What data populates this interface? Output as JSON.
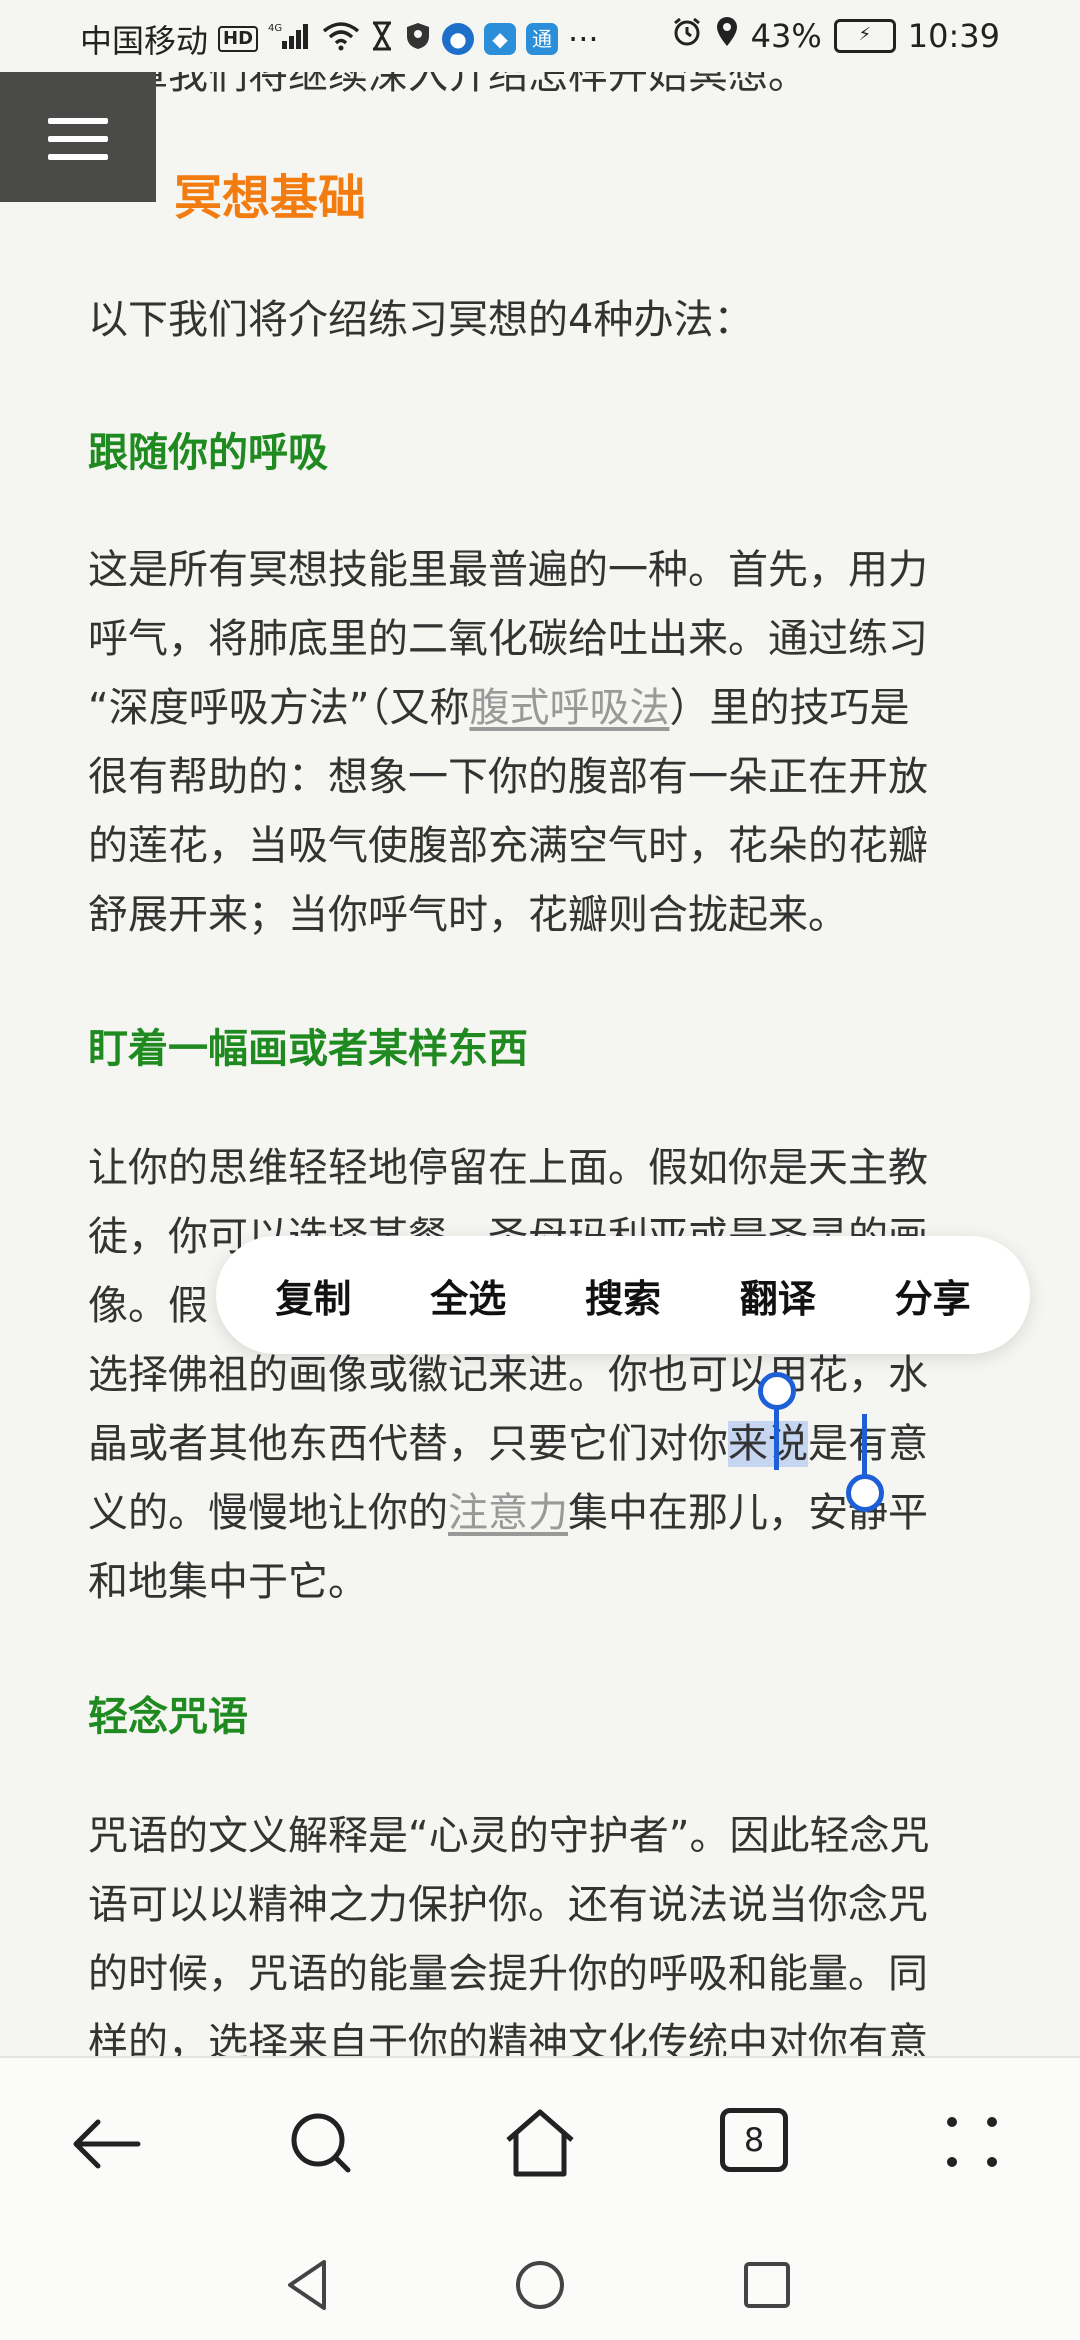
{
  "status_bar": {
    "carrier": "中国移动",
    "hd_badge": "HD",
    "network": "4G",
    "battery": "43%",
    "time": "10:39",
    "more": "···"
  },
  "article": {
    "cut_line": "文章我们将继续深入介绍怎样开始冥想。",
    "section_title": "冥想基础",
    "intro": "以下我们将介绍练习冥想的4种办法：",
    "sections": [
      {
        "heading": "跟随你的呼吸",
        "lines": [
          "这是所有冥想技能里最普遍的一种。首先，用力",
          "呼气，将肺底里的二氧化碳给吐出来。通过练习",
          "“深度呼吸方法”（又称",
          "腹式呼吸法",
          "）里的技巧是",
          "很有帮助的：想象一下你的腹部有一朵正在开放",
          "的莲花，当吸气使腹部充满空气时，花朵的花瓣",
          "舒展开来；当你呼气时，花瓣则合拢起来。"
        ]
      },
      {
        "heading": "盯着一幅画或者某样东西",
        "lines": [
          "让你的思维轻轻地停留在上面。假如你是天主教",
          "徒，你可以选择某餐、圣母玛利亚或是圣灵的画",
          "像。假",
          "选择佛祖的画像或徽记来进。你也可以用花，水",
          "晶或者其他东西代替，只要它们对你",
          "来说",
          "是有意",
          "义的。慢慢地让你的",
          "注意力",
          "集中在那儿，安静平",
          "和地集中于它。"
        ]
      },
      {
        "heading": "轻念咒语",
        "lines": [
          "咒语的文义解释是“心灵的守护者”。因此轻念咒",
          "语可以以精神之力保护你。还有说法说当你念咒",
          "的时候，咒语的能量会提升你的呼吸和能量。同",
          "样的，选择来自于你的精神文化传统中对你有意"
        ]
      }
    ]
  },
  "selection_menu": {
    "copy": "复制",
    "select_all": "全选",
    "search": "搜索",
    "translate": "翻译",
    "share": "分享"
  },
  "toolbar": {
    "tab_count": "8"
  },
  "colors": {
    "accent_orange": "#f27c10",
    "heading_green": "#1f8a1f",
    "selection_blue": "#1d5fd6"
  }
}
